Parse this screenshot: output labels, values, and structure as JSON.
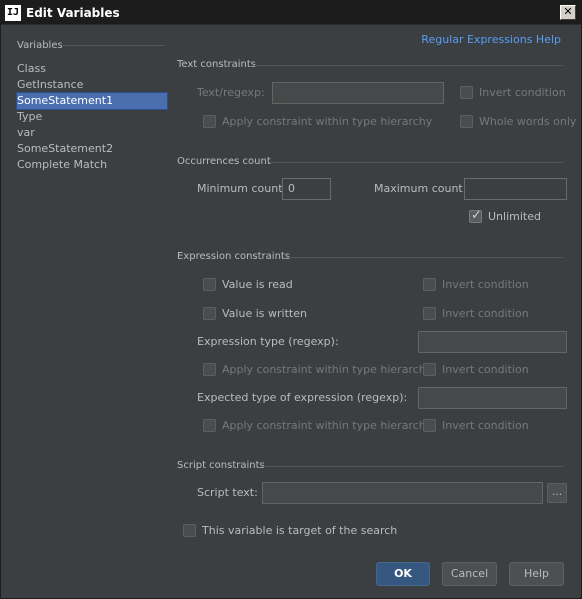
{
  "window": {
    "title": "Edit Variables",
    "app_icon": "IJ",
    "close_label": "✕"
  },
  "variables": {
    "header": "Variables",
    "items": [
      {
        "label": "Class"
      },
      {
        "label": "GetInstance"
      },
      {
        "label": "SomeStatement1"
      },
      {
        "label": "Type"
      },
      {
        "label": "var"
      },
      {
        "label": "SomeStatement2"
      },
      {
        "label": "Complete Match"
      }
    ],
    "selected_index": 2
  },
  "help_link": "Regular Expressions Help",
  "text_constraints": {
    "title": "Text constraints",
    "text_regexp_label": "Text/regexp:",
    "text_regexp_value": "",
    "invert_condition": "Invert condition",
    "apply_hierarchy": "Apply constraint within type hierarchy",
    "whole_words": "Whole words only"
  },
  "occurrences": {
    "title": "Occurrences count",
    "min_label": "Minimum count:",
    "min_value": "0",
    "max_label": "Maximum count:",
    "max_value": "",
    "unlimited": "Unlimited",
    "unlimited_checked": true
  },
  "expression_constraints": {
    "title": "Expression constraints",
    "value_read": "Value is read",
    "value_written": "Value is written",
    "invert_condition": "Invert condition",
    "expr_type_label": "Expression type (regexp):",
    "apply_hierarchy": "Apply constraint within type hierarchy",
    "expected_type_label": "Expected type of expression (regexp):"
  },
  "script_constraints": {
    "title": "Script constraints",
    "script_label": "Script text:",
    "script_value": "",
    "browse_label": "..."
  },
  "target_label": "This variable is target of the search",
  "buttons": {
    "ok": "OK",
    "cancel": "Cancel",
    "help": "Help"
  },
  "colors": {
    "background": "#3c3f41",
    "selection": "#4b6eaf",
    "link": "#589df6",
    "default_button": "#365880"
  }
}
